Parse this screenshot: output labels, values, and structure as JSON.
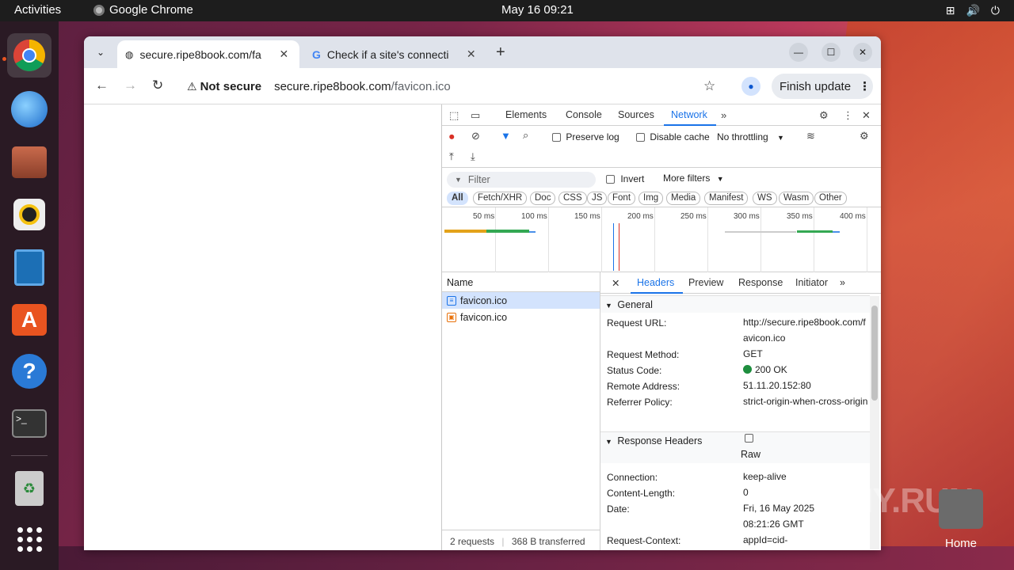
{
  "topbar": {
    "activities": "Activities",
    "app_name": "Google Chrome",
    "clock": "May 16  09:21"
  },
  "browser": {
    "tabs": [
      {
        "label": "secure.ripe8book.com/fa",
        "active": true
      },
      {
        "label": "Check if a site's connecti",
        "active": false
      }
    ],
    "omnibox": {
      "security_label": "Not secure",
      "host": "secure.ripe8book.com",
      "path": "/favicon.ico"
    },
    "finish_update": "Finish update"
  },
  "devtools": {
    "tabs": [
      "Elements",
      "Console",
      "Sources",
      "Network"
    ],
    "active_tab": "Network",
    "preserve_log": "Preserve log",
    "disable_cache": "Disable cache",
    "throttling": "No throttling",
    "filter_placeholder": "Filter",
    "invert": "Invert",
    "more_filters": "More filters",
    "type_filters": [
      "All",
      "Fetch/XHR",
      "Doc",
      "CSS",
      "JS",
      "Font",
      "Img",
      "Media",
      "Manifest",
      "WS",
      "Wasm",
      "Other"
    ],
    "timeline_ticks": [
      "50 ms",
      "100 ms",
      "150 ms",
      "200 ms",
      "250 ms",
      "300 ms",
      "350 ms",
      "400 ms"
    ],
    "name_header": "Name",
    "requests": [
      "favicon.ico",
      "favicon.ico"
    ],
    "summary": {
      "requests": "2 requests",
      "transferred": "368 B transferred"
    },
    "detail_tabs": [
      "Headers",
      "Preview",
      "Response",
      "Initiator"
    ],
    "general": {
      "title": "General",
      "request_url_label": "Request URL:",
      "request_url": "http://secure.ripe8book.com/favicon.ico",
      "method_label": "Request Method:",
      "method": "GET",
      "status_label": "Status Code:",
      "status": "200 OK",
      "remote_label": "Remote Address:",
      "remote": "51.11.20.152:80",
      "referrer_label": "Referrer Policy:",
      "referrer": "strict-origin-when-cross-origin"
    },
    "response_headers": {
      "title": "Response Headers",
      "raw": "Raw",
      "connection_label": "Connection:",
      "connection": "keep-alive",
      "length_label": "Content-Length:",
      "length": "0",
      "date_label": "Date:",
      "date": "Fri, 16 May 2025 08:21:26 GMT",
      "context_label": "Request-Context:",
      "context": "appId=cid-"
    }
  },
  "desktop": {
    "home_label": "Home",
    "watermark": "ANY.RUN"
  },
  "colors": {
    "accent": "#1a73e8",
    "status_ok": "#1e8e3e",
    "ubuntu_orange": "#e95420"
  }
}
